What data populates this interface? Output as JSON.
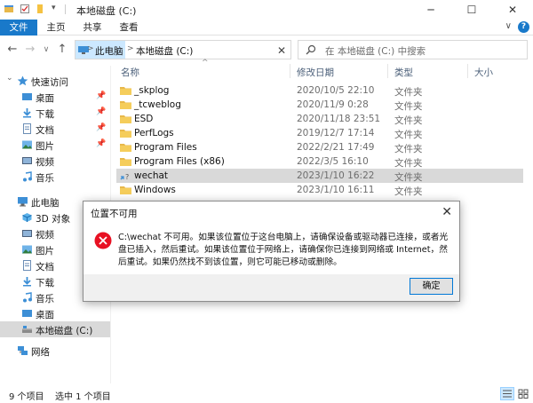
{
  "window": {
    "title": "本地磁盘 (C:)",
    "minimize": "─",
    "maximize": "☐",
    "close": "✕"
  },
  "ribbon": {
    "tabs": [
      "文件",
      "主页",
      "共享",
      "查看"
    ],
    "expand": "∨"
  },
  "nav": {
    "back": "←",
    "forward": "→",
    "recent": "∨",
    "up": "↑",
    "breadcrumb": [
      "此电脑",
      "本地磁盘 (C:)"
    ],
    "separator": ">",
    "clear": "✕",
    "search_placeholder": "在 本地磁盘 (C:) 中搜索"
  },
  "sidebar": {
    "items": [
      {
        "label": "快速访问",
        "icon": "star-icon",
        "pinned": false
      },
      {
        "label": "桌面",
        "icon": "desktop-icon",
        "pinned": true
      },
      {
        "label": "下载",
        "icon": "download-icon",
        "pinned": true
      },
      {
        "label": "文档",
        "icon": "document-icon",
        "pinned": true
      },
      {
        "label": "图片",
        "icon": "picture-icon",
        "pinned": true
      },
      {
        "label": "视频",
        "icon": "video-icon",
        "pinned": false
      },
      {
        "label": "音乐",
        "icon": "music-icon",
        "pinned": false
      },
      {
        "label": "此电脑",
        "icon": "computer-icon",
        "pinned": false
      },
      {
        "label": "3D 对象",
        "icon": "cube-icon",
        "pinned": false
      },
      {
        "label": "视频",
        "icon": "video-icon",
        "pinned": false
      },
      {
        "label": "图片",
        "icon": "picture-icon",
        "pinned": false
      },
      {
        "label": "文档",
        "icon": "document-icon",
        "pinned": false
      },
      {
        "label": "下载",
        "icon": "download-icon",
        "pinned": false
      },
      {
        "label": "音乐",
        "icon": "music-icon",
        "pinned": false
      },
      {
        "label": "桌面",
        "icon": "desktop-icon",
        "pinned": false
      },
      {
        "label": "本地磁盘 (C:)",
        "icon": "drive-icon",
        "pinned": false
      },
      {
        "label": "网络",
        "icon": "network-icon",
        "pinned": false
      }
    ]
  },
  "columns": {
    "name": "名称",
    "date": "修改日期",
    "type": "类型",
    "size": "大小"
  },
  "files": [
    {
      "name": "_skplog",
      "date": "2020/10/5 22:10",
      "type": "文件夹",
      "shortcut": false
    },
    {
      "name": "_tcweblog",
      "date": "2020/11/9 0:28",
      "type": "文件夹",
      "shortcut": false
    },
    {
      "name": "ESD",
      "date": "2020/11/18 23:51",
      "type": "文件夹",
      "shortcut": false
    },
    {
      "name": "PerfLogs",
      "date": "2019/12/7 17:14",
      "type": "文件夹",
      "shortcut": false
    },
    {
      "name": "Program Files",
      "date": "2022/2/21 17:49",
      "type": "文件夹",
      "shortcut": false
    },
    {
      "name": "Program Files (x86)",
      "date": "2022/3/5 16:10",
      "type": "文件夹",
      "shortcut": false
    },
    {
      "name": "wechat",
      "date": "2023/1/10 16:22",
      "type": "文件夹",
      "shortcut": true
    },
    {
      "name": "Windows",
      "date": "2023/1/10 16:11",
      "type": "文件夹",
      "shortcut": false
    }
  ],
  "status": {
    "count": "9 个项目",
    "selected": "选中 1 个项目"
  },
  "dialog": {
    "title": "位置不可用",
    "close": "✕",
    "message": "C:\\wechat 不可用。如果该位置位于这台电脑上，请确保设备或驱动器已连接，或者光盘已插入，然后重试。如果该位置位于网络上，请确保你已连接到网络或 Internet，然后重试。如果仍然找不到该位置，则它可能已移动或删除。",
    "ok": "确定"
  },
  "colors": {
    "accent": "#1979ca",
    "selection": "#d9d9d9",
    "folder": "#e8b84a",
    "error": "#e81123"
  }
}
